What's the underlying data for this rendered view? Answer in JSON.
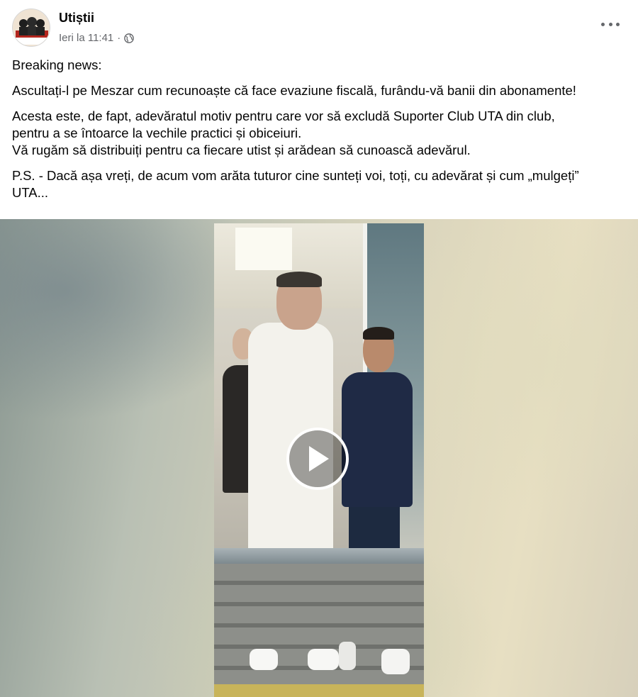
{
  "post": {
    "page_name": "Utiștii",
    "timestamp": "Ieri la 11:41",
    "separator": "·",
    "privacy_icon": "globe-icon",
    "more_icon": "more-options-icon",
    "avatar_icon": "page-avatar",
    "paragraphs": [
      "Breaking news:",
      "Ascultați-l pe Meszar cum recunoaște că face evaziune fiscală, furându-vă banii din abonamente!",
      "Acesta este, de fapt, adevăratul motiv pentru care vor să excludă Suporter Club UTA din club,\npentru a se întoarce la vechile practici și obiceiuri.\nVă rugăm să distribuiți pentru ca fiecare utist și arădean să cunoască adevărul.",
      "P.S. - Dacă așa vreți, de acum vom arăta tuturor cine sunteți voi, toți, cu adevărat și cum „mulgeți”\nUTA..."
    ]
  },
  "video": {
    "play_icon": "play-icon"
  },
  "colors": {
    "text_primary": "#050505",
    "text_secondary": "#65676b",
    "background": "#ffffff"
  }
}
